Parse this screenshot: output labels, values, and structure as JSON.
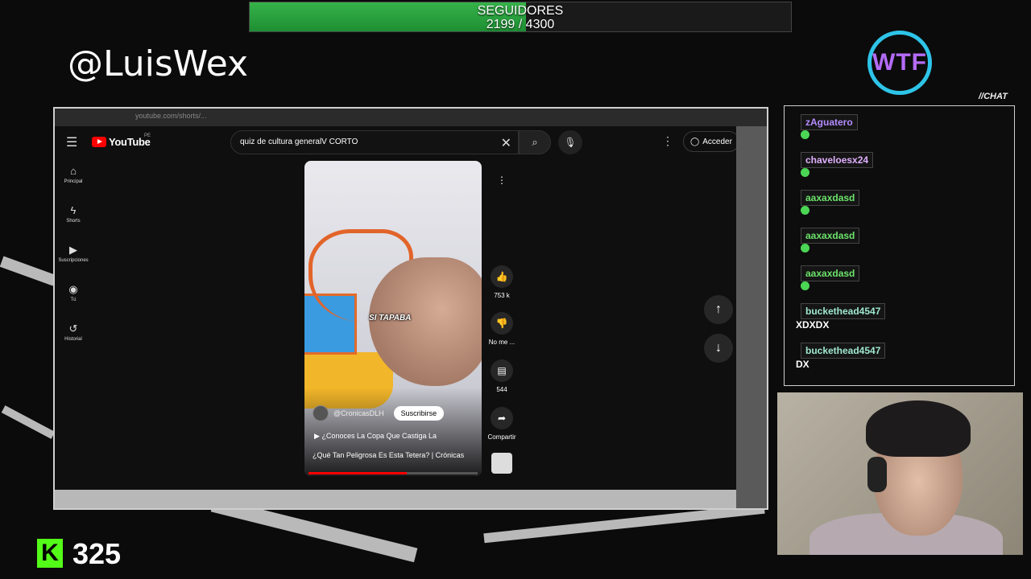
{
  "followers": {
    "label": "SEGUIDORES",
    "current": "2199",
    "separator": "/",
    "goal": "4300",
    "progress": 0.51
  },
  "streamer_handle": "@LuisWex",
  "logo_text": "WTF",
  "chat_label": "//CHAT",
  "browser": {
    "url": "youtube.com/shorts/...",
    "brand": "YouTube",
    "region": "PE",
    "search_query": "quiz de cultura generalV CORTO",
    "sign_in": "Acceder",
    "sidebar": [
      {
        "label": "Principal",
        "icon": "home-icon",
        "glyph": "⌂"
      },
      {
        "label": "Shorts",
        "icon": "shorts-icon",
        "glyph": "ϟ"
      },
      {
        "label": "Suscripciones",
        "icon": "subscriptions-icon",
        "glyph": "▶"
      },
      {
        "label": "Tú",
        "icon": "user-icon",
        "glyph": "◉"
      },
      {
        "label": "Historial",
        "icon": "history-icon",
        "glyph": "↺"
      }
    ]
  },
  "video": {
    "caption": "SI TAPABA",
    "channel": "@CronicasDLH",
    "subscribe": "Suscribirse",
    "title_line1": "¿Conoces La Copa Que Castiga La",
    "title_line2": "¿Qué Tan Peligrosa Es Esta Tetera? | Crónicas",
    "progress": 0.58,
    "likes": "753 k",
    "dislike": "No me ...",
    "comments": "544",
    "share": "Compartir"
  },
  "chat": {
    "messages": [
      {
        "user": "zAguatero",
        "color": "#b48cff",
        "text": ""
      },
      {
        "user": "chaveloesx24",
        "color": "#e0b0ff",
        "text": ""
      },
      {
        "user": "aaxaxdasd",
        "color": "#6be36b",
        "text": ""
      },
      {
        "user": "aaxaxdasd",
        "color": "#6be36b",
        "text": ""
      },
      {
        "user": "aaxaxdasd",
        "color": "#6be36b",
        "text": ""
      },
      {
        "user": "buckethead4547",
        "color": "#9fe8d0",
        "text": "XDXDX"
      },
      {
        "user": "buckethead4547",
        "color": "#9fe8d0",
        "text": "DX"
      }
    ]
  },
  "kick": {
    "count": "325"
  },
  "colors": {
    "accent_green": "#53fc18",
    "follow_bar": "#36b34a",
    "yt_red": "#ff0000"
  }
}
